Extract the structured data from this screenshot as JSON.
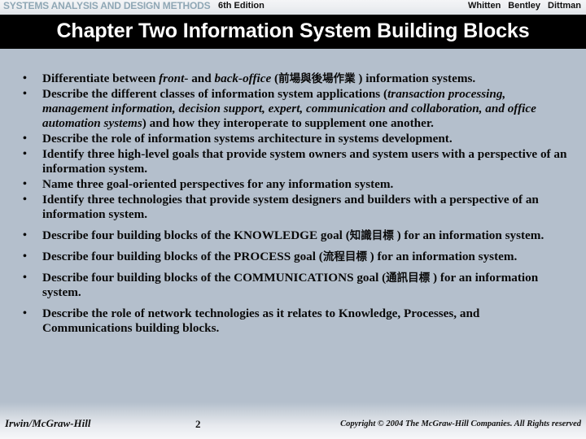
{
  "header": {
    "book_title": "SYSTEMS ANALYSIS AND DESIGN METHODS",
    "edition": "6th Edition",
    "authors": [
      "Whitten",
      "Bentley",
      "Dittman"
    ],
    "title_color": "#8fa7b5"
  },
  "banner": {
    "chapter_title": "Chapter Two  Information System Building Blocks",
    "background": "#000000",
    "text_color": "#ffffff"
  },
  "slide": {
    "background": "#b4bfcc",
    "bullet_marker": "•"
  },
  "bullets": [
    {
      "id": "bullet-front-back-office",
      "parts": [
        {
          "t": "Differentiate between ",
          "s": "n"
        },
        {
          "t": "front-",
          "s": "i"
        },
        {
          "t": " and ",
          "s": "n"
        },
        {
          "t": "back-office",
          "s": "i"
        },
        {
          "t": " (",
          "s": "n"
        },
        {
          "t": "前場與後場作業",
          "s": "c"
        },
        {
          "t": "  ) information systems.",
          "s": "n"
        }
      ]
    },
    {
      "id": "bullet-classes-of-is-applications",
      "parts": [
        {
          "t": "Describe the different classes of information system applications (",
          "s": "n"
        },
        {
          "t": "transaction processing, management information, decision support, expert, communication and collaboration, and office automation systems",
          "s": "i"
        },
        {
          "t": ") and how they interoperate to supplement one another.",
          "s": "n"
        }
      ]
    },
    {
      "id": "bullet-is-architecture-role",
      "parts": [
        {
          "t": "Describe the role of information systems architecture in systems development.",
          "s": "n"
        }
      ]
    },
    {
      "id": "bullet-three-high-level-goals",
      "parts": [
        {
          "t": "Identify three high-level goals that provide system owners and system users with a perspective of an information system.",
          "s": "n"
        }
      ]
    },
    {
      "id": "bullet-three-goal-oriented-perspectives",
      "parts": [
        {
          "t": "Name three goal-oriented perspectives for any information system.",
          "s": "n"
        }
      ]
    },
    {
      "id": "bullet-three-technologies",
      "parts": [
        {
          "t": "Identify three technologies that provide system designers and builders with a perspective of an information system.",
          "s": "n"
        }
      ]
    },
    {
      "id": "bullet-knowledge-goal",
      "gap": true,
      "parts": [
        {
          "t": "Describe four building blocks of the KNOWLEDGE goal (",
          "s": "n"
        },
        {
          "t": "知識目標",
          "s": "c"
        },
        {
          "t": "  ) for an information system.",
          "s": "n"
        }
      ]
    },
    {
      "id": "bullet-process-goal",
      "gap": true,
      "parts": [
        {
          "t": "Describe four building blocks of the PROCESS goal (",
          "s": "n"
        },
        {
          "t": "流程目標",
          "s": "c"
        },
        {
          "t": "  ) for an information system.",
          "s": "n"
        }
      ]
    },
    {
      "id": "bullet-communications-goal",
      "gap": true,
      "parts": [
        {
          "t": "Describe four building blocks of the COMMUNICATIONS goal (",
          "s": "n"
        },
        {
          "t": "通訊目標",
          "s": "c"
        },
        {
          "t": "  ) for an information system.",
          "s": "n"
        }
      ]
    },
    {
      "id": "bullet-network-technologies-role",
      "gap": true,
      "parts": [
        {
          "t": "Describe the role of network technologies as it relates to Knowledge, Processes, and Communications building blocks.",
          "s": "n"
        }
      ]
    }
  ],
  "footer": {
    "publisher": "Irwin/McGraw-Hill",
    "page_number": "2",
    "copyright": "Copyright © 2004 The McGraw-Hill Companies. All Rights reserved"
  }
}
